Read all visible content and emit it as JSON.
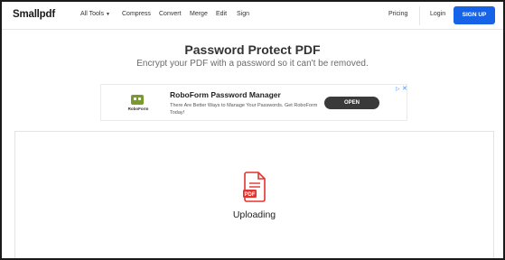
{
  "navbar": {
    "logo": "Smallpdf",
    "all_tools": "All Tools",
    "compress": "Compress",
    "convert": "Convert",
    "merge": "Merge",
    "edit": "Edit",
    "sign": "Sign",
    "pricing": "Pricing",
    "login": "Login",
    "signup": "SIGN UP"
  },
  "header": {
    "title": "Password Protect PDF",
    "subtitle": "Encrypt your PDF with a password so it can't be removed."
  },
  "ad": {
    "logo_text": "RoboForm",
    "title": "RoboForm Password Manager",
    "description": "There Are Better Ways to Manage Your Passwords. Get RoboForm Today!",
    "button": "OPEN"
  },
  "upload": {
    "file_badge": "PDF",
    "status": "Uploading"
  },
  "colors": {
    "accent": "#1763e8",
    "pdf_red": "#e5322d",
    "ad_button": "#3a3a3a"
  }
}
